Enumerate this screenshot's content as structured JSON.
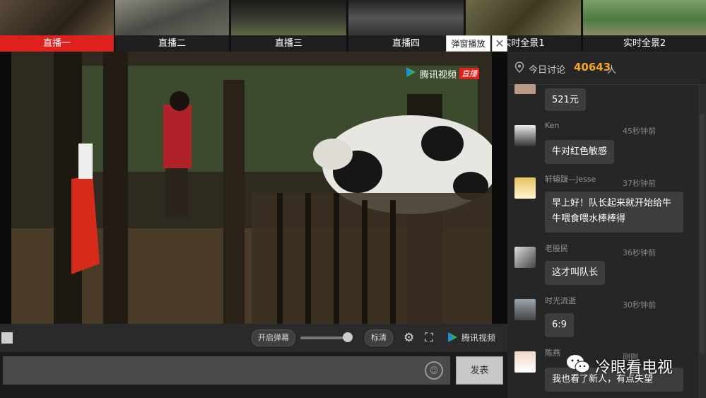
{
  "tabs": [
    {
      "label": "直播一",
      "active": true
    },
    {
      "label": "直播二",
      "active": false
    },
    {
      "label": "直播三",
      "active": false
    },
    {
      "label": "直播四",
      "active": false
    },
    {
      "label": "实时全景1",
      "active": false
    },
    {
      "label": "实时全景2",
      "active": false
    }
  ],
  "popup": {
    "label": "弹窗播放",
    "close": "✕"
  },
  "watermark": {
    "brand": "腾讯视频",
    "live": "直播"
  },
  "controls": {
    "danmaku_label": "开启弹幕",
    "volume": 0.9,
    "quality_label": "标清",
    "settings_icon": "gear-icon",
    "fullscreen_icon": "fullscreen-icon",
    "brand": "腾讯视频"
  },
  "composer": {
    "placeholder": "",
    "send_label": "发表"
  },
  "chat": {
    "title": "今日讨论",
    "count": "40643",
    "unit": "人",
    "messages": [
      {
        "user": "",
        "time": "",
        "text": "521元"
      },
      {
        "user": "Ken",
        "time": "45秒钟前",
        "text": "牛对红色敏感"
      },
      {
        "user": "轩辕跋—Jesse",
        "time": "37秒钟前",
        "text": "早上好！队长起来就开始给牛牛喂食喂水棒棒得"
      },
      {
        "user": "老股民",
        "time": "36秒钟前",
        "text": "这才叫队长"
      },
      {
        "user": "时光流逝",
        "time": "30秒钟前",
        "text": "6:9"
      },
      {
        "user": "陈燕",
        "time": "刚刚",
        "text": "我也看了新人，有点失望"
      }
    ]
  },
  "overlay_brand": "冷眼看电视",
  "colors": {
    "accent": "#e0201d",
    "count": "#f5a623"
  }
}
